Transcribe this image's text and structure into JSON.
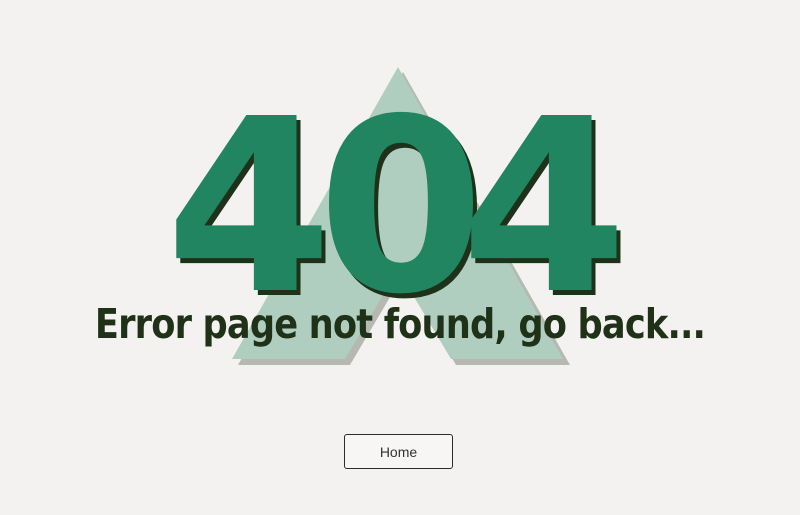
{
  "error": {
    "digit1": "4",
    "digit2": "0",
    "digit3": "4",
    "message": "Error page not found, go back..."
  },
  "actions": {
    "home_label": "Home"
  },
  "colors": {
    "background": "#f4f2f0",
    "brand_green": "#208560",
    "shadow_dark": "#1d3219",
    "triangle_light": "#afcebf",
    "triangle_shadow": "#b7b8b2",
    "text_dark": "#1f3218"
  }
}
